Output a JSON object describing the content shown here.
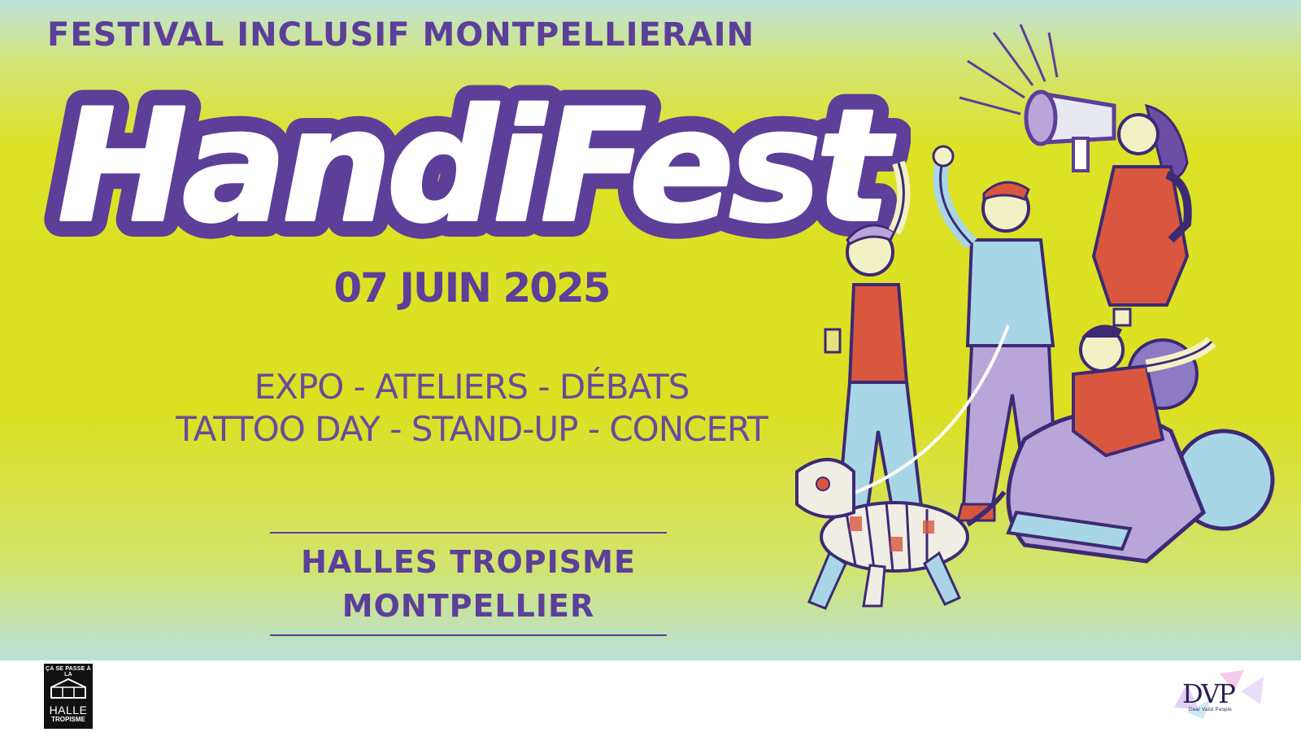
{
  "poster": {
    "tagline": "FESTIVAL INCLUSIF MONTPELLIERAIN",
    "title": "HandiFest",
    "date": "07 JUIN 2025",
    "activities_line1": "EXPO - ATELIERS - DÉBATS",
    "activities_line2": "TATTOO DAY - STAND-UP - CONCERT",
    "venue_line1": "HALLES TROPISME",
    "venue_line2": "MONTPELLIER"
  },
  "footer": {
    "halle_logo": {
      "top_text": "ÇA SE PASSE À LA",
      "name": "HALLE",
      "sub": "TROPISME"
    },
    "dvp_logo": {
      "letters": "DVP",
      "sub": "Dear Valid People"
    }
  },
  "colors": {
    "purple": "#5b3f99",
    "lime": "#dde021",
    "mint": "#bfe3dc",
    "red": "#d9573f",
    "light_blue": "#a9d6e6"
  },
  "icons": [
    "halle-tropisme-logo-icon",
    "dvp-logo-icon",
    "megaphone-icon",
    "robot-dog-icon"
  ]
}
